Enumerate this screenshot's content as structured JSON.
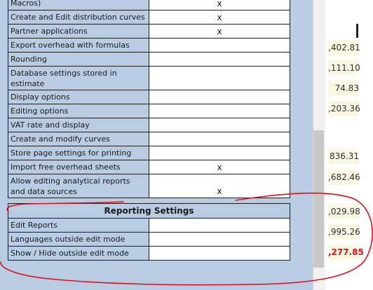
{
  "main_table": {
    "rows": [
      {
        "label": "Macros)",
        "mark": "x"
      },
      {
        "label": "Create and Edit distribution curves",
        "mark": "x"
      },
      {
        "label": "Partner applications",
        "mark": "x"
      },
      {
        "label": "Export overhead with formulas",
        "mark": ""
      },
      {
        "label": "Rounding",
        "mark": ""
      },
      {
        "label": "Database settings stored in estimate",
        "mark": ""
      },
      {
        "label": "Display options",
        "mark": ""
      },
      {
        "label": "Editing options",
        "mark": ""
      },
      {
        "label": "VAT rate and display",
        "mark": ""
      },
      {
        "label": "Create and modify curves",
        "mark": ""
      },
      {
        "label": "Store page settings for printing",
        "mark": ""
      },
      {
        "label": "Import free overhead sheets",
        "mark": "x"
      },
      {
        "label": "Allow editing analytical reports and data sources",
        "mark": "x"
      }
    ]
  },
  "reporting": {
    "header": "Reporting Settings",
    "rows": [
      {
        "label": "Edit Reports",
        "mark": ""
      },
      {
        "label": "Languages outside edit mode",
        "mark": ""
      },
      {
        "label": "Show / Hide outside edit mode",
        "mark": ""
      }
    ]
  },
  "right_values": [
    {
      "text": ",402.81",
      "red": false
    },
    {
      "text": ",111.10",
      "red": false
    },
    {
      "text": "74.83",
      "red": false
    },
    {
      "text": ",203.36",
      "red": false
    },
    {
      "text": "836.31",
      "red": false
    },
    {
      "text": ",682.46",
      "red": false
    },
    {
      "text": ",029.98",
      "red": false
    },
    {
      "text": ",995.26",
      "red": false
    },
    {
      "text": ",277.85",
      "red": true
    }
  ],
  "colors": {
    "cell_blue": "#b8cde4",
    "annotation_red": "#e0101a",
    "value_bg": "#fbf7e3"
  }
}
